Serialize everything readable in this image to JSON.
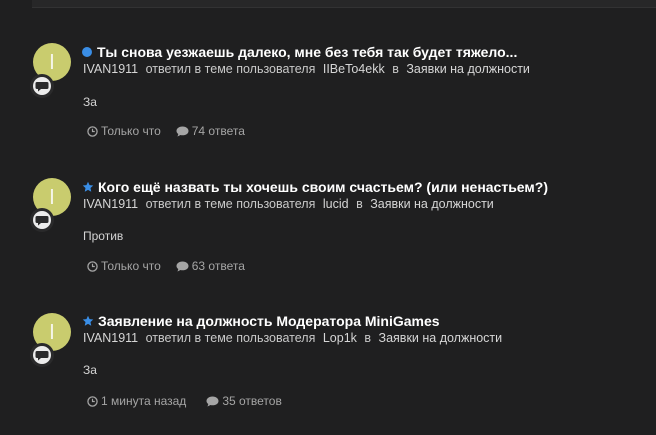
{
  "activity": [
    {
      "marker": "unread-dot-icon",
      "title": "Ты снова уезжаешь далеко, мне без тебя так будет тяжело...",
      "author": "IVAN1911",
      "action": "ответил в теме пользователя",
      "topic_user": "IIBeTo4ekk",
      "preposition": "в",
      "forum": "Заявки на должности",
      "snippet": "За",
      "time": "Только что",
      "replies": "74 ответа",
      "avatar_letter": "I"
    },
    {
      "marker": "star-icon",
      "title": "Кого ещё назвать ты хочешь своим счастьем? (или ненастьем?)",
      "author": "IVAN1911",
      "action": "ответил в теме пользователя",
      "topic_user": "lucid",
      "preposition": "в",
      "forum": "Заявки на должности",
      "snippet": "Против",
      "time": "Только что",
      "replies": "63 ответа",
      "avatar_letter": "I"
    },
    {
      "marker": "star-icon",
      "title": "Заявление на должность Модератора MiniGames",
      "author": "IVAN1911",
      "action": "ответил в теме пользователя",
      "topic_user": "Lop1k",
      "preposition": "в",
      "forum": "Заявки на должности",
      "snippet": "За",
      "time": "1 минута назад",
      "replies": "35 ответов",
      "avatar_letter": "I"
    }
  ],
  "colors": {
    "background": "#1f1f20",
    "accent": "#3a8ee6",
    "avatar": "#c9cc6e"
  }
}
